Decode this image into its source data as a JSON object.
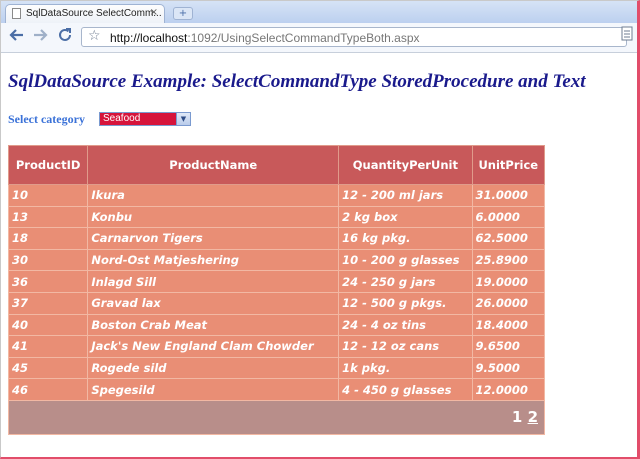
{
  "browser": {
    "tab_title": "SqlDataSource SelectComm...",
    "tab_close": "×",
    "new_tab": "+",
    "url_host": "http://localhost",
    "url_path": ":1092/UsingSelectCommandTypeBoth.aspx"
  },
  "page": {
    "heading": "SqlDataSource Example: SelectCommandType StoredProcedure and Text",
    "select_label": "Select category",
    "select_value": "Seafood"
  },
  "grid": {
    "columns": [
      "ProductID",
      "ProductName",
      "QuantityPerUnit",
      "UnitPrice"
    ],
    "rows": [
      [
        "10",
        "Ikura",
        "12 - 200 ml jars",
        "31.0000"
      ],
      [
        "13",
        "Konbu",
        "2 kg box",
        "6.0000"
      ],
      [
        "18",
        "Carnarvon Tigers",
        "16 kg pkg.",
        "62.5000"
      ],
      [
        "30",
        "Nord-Ost Matjeshering",
        "10 - 200 g glasses",
        "25.8900"
      ],
      [
        "36",
        "Inlagd Sill",
        "24 - 250 g jars",
        "19.0000"
      ],
      [
        "37",
        "Gravad lax",
        "12 - 500 g pkgs.",
        "26.0000"
      ],
      [
        "40",
        "Boston Crab Meat",
        "24 - 4 oz tins",
        "18.4000"
      ],
      [
        "41",
        "Jack's New England Clam Chowder",
        "12 - 12 oz cans",
        "9.6500"
      ],
      [
        "45",
        "Rogede sild",
        "1k pkg.",
        "9.5000"
      ],
      [
        "46",
        "Spegesild",
        "4 - 450 g glasses",
        "12.0000"
      ]
    ],
    "pager": [
      "1",
      "2"
    ]
  }
}
